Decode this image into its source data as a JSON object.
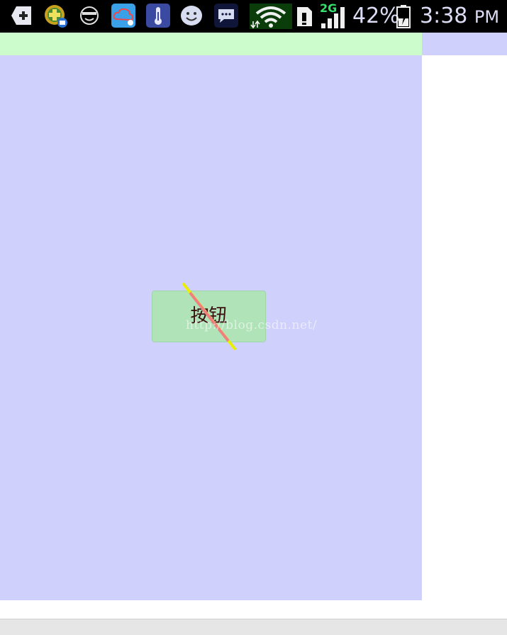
{
  "status_bar": {
    "notification_icons": [
      "add-icon",
      "contacts-mail-icon",
      "sunglasses-face-icon",
      "cloud-sync-icon",
      "thermometer-icon",
      "smiley-face-icon",
      "chat-bubble-icon"
    ],
    "network_type": "2G",
    "battery_percent": "42%",
    "battery_level": 0.42,
    "time": "3:38",
    "ampm": "PM"
  },
  "content": {
    "button_label": "按钮",
    "watermark": "http://blog.csdn.net/"
  },
  "colors": {
    "status_bar_bg": "#000000",
    "top_band": "#ccfccc",
    "main_panel": "#d0d0fc",
    "button_bg": "#b0e4b8",
    "line_yellow": "#e8f000",
    "line_red": "#f08080"
  }
}
